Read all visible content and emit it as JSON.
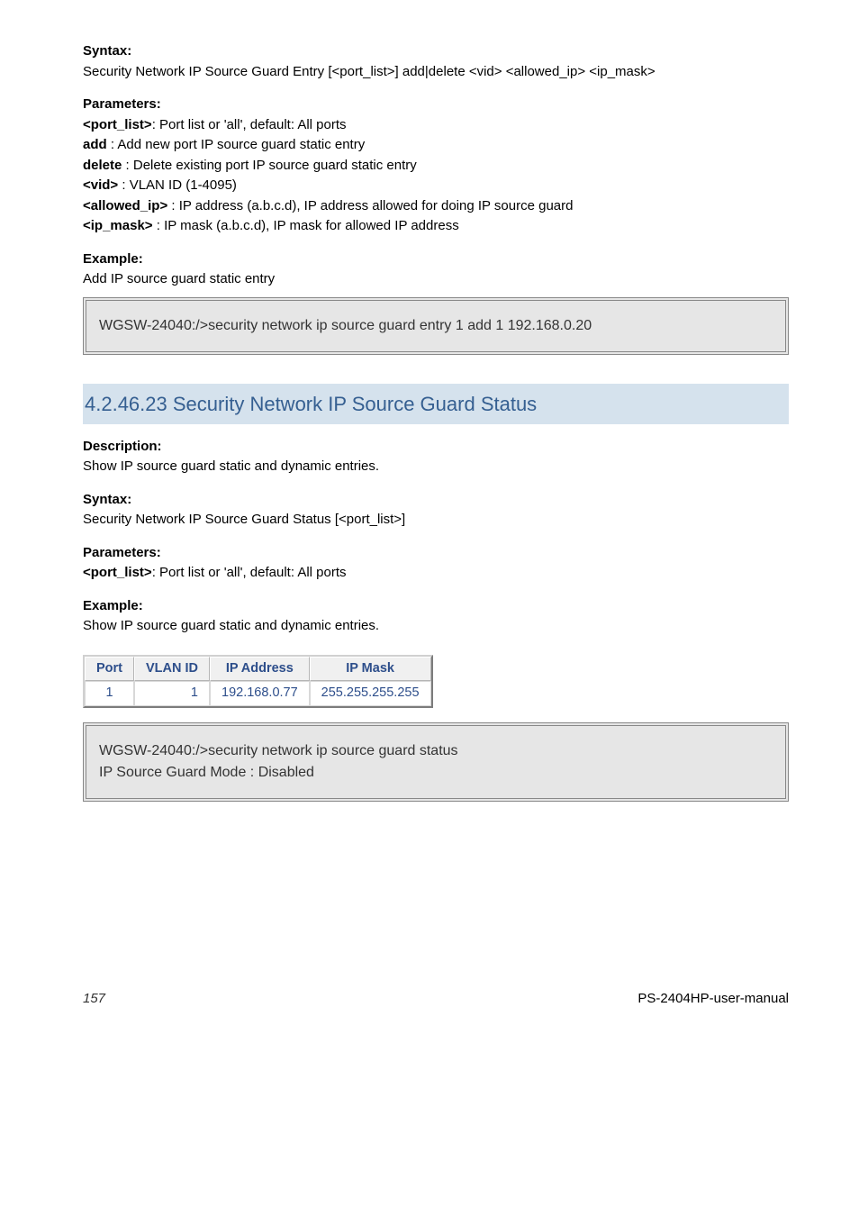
{
  "section24622": {
    "syntax_label": "Syntax:",
    "syntax_cmd": "Security Network IP Source Guard Entry [<port_list>] add|delete <vid> <allowed_ip> <ip_mask>",
    "params_label": "Parameters:",
    "params": [
      {
        "tag": "<port_list>",
        "desc": ": Port list or 'all', default: All ports"
      },
      {
        "tag": "add",
        "desc": "           : Add new port IP source guard static entry"
      },
      {
        "tag": "delete",
        "desc": "         : Delete existing port IP source guard static entry"
      },
      {
        "tag": "<vid>",
        "desc": "       : VLAN ID (1-4095)"
      },
      {
        "tag": "<allowed_ip>",
        "desc": " : IP address (a.b.c.d), IP address allowed for doing IP source guard"
      },
      {
        "tag": "<ip_mask>",
        "desc": "    : IP mask (a.b.c.d), IP mask for allowed IP address"
      }
    ],
    "example_label": "Example:",
    "example_sentence": "Add IP source guard static entry",
    "example_cmd": "WGSW-24040:/>security network ip source guard entry 1 add 1 192.168.0.20"
  },
  "section24623": {
    "heading": "4.2.46.23  Security Network IP Source Guard Status",
    "desc_label": "Description:",
    "desc_text": "Show IP source guard static and dynamic entries.",
    "syntax_label": "Syntax:",
    "syntax_cmd": "Security Network IP Source Guard Status [<port_list>]",
    "params_label": "Parameters:",
    "params": [
      {
        "tag": "<port_list>",
        "desc": ": Port list or 'all', default: All ports"
      }
    ],
    "example_label": "Example:",
    "example_sentence": "Show IP source guard static and dynamic entries.",
    "table": {
      "headers": [
        "Port",
        "VLAN ID",
        "IP Address",
        "IP Mask"
      ],
      "rows": [
        {
          "port": "1",
          "vlan": "1",
          "ip": "192.168.0.77",
          "mask": "255.255.255.255"
        }
      ]
    },
    "example_cmds": [
      "WGSW-24040:/>security network ip source guard status",
      "IP Source Guard Mode : Disabled"
    ]
  },
  "footer": {
    "pageno": "157",
    "manual": "PS-2404HP-user-manual"
  }
}
